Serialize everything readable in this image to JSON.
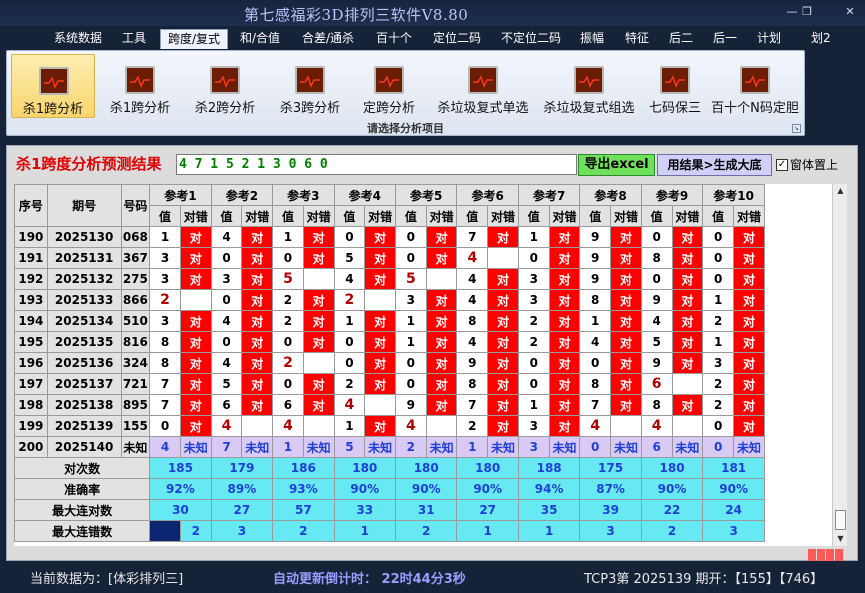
{
  "window": {
    "title": "第七感福彩3D排列三软件V8.80",
    "minimize": "—",
    "restore": "❐",
    "close": "✕"
  },
  "menu": [
    "系统数据",
    "工具",
    "跨度/复式",
    "和/合值",
    "合差/通杀",
    "百十个",
    "定位二码",
    "不定位二码",
    "振幅",
    "特征",
    "后二",
    "后一",
    "计划",
    "划2"
  ],
  "ribbon": {
    "buttons": [
      "杀1跨分析",
      "杀1跨分析",
      "杀2跨分析",
      "杀3跨分析",
      "定跨分析",
      "杀垃圾复式单选",
      "杀垃圾复式组选",
      "七码保三",
      "百十个N码定胆"
    ],
    "group_label": "请选择分析项目"
  },
  "result": {
    "title": "杀1跨度分析预测结果",
    "values": "4 7 1 5 2 1 3 0 6 0",
    "export_button": "导出excel",
    "generate_button": "用结果>生成大底",
    "topmost_label": "窗体置上",
    "topmost_checked": "✓"
  },
  "grid": {
    "headers": {
      "seq": "序号",
      "period": "期号",
      "number": "号码",
      "refs": [
        "参考1",
        "参考2",
        "参考3",
        "参考4",
        "参考5",
        "参考6",
        "参考7",
        "参考8",
        "参考9",
        "参考10"
      ],
      "val": "值",
      "judge": "对错"
    },
    "hit_text": "对",
    "rows": [
      {
        "seq": "190",
        "period": "2025130",
        "number": "068",
        "vals": [
          "1",
          "4",
          "1",
          "0",
          "0",
          "7",
          "1",
          "9",
          "0",
          "0"
        ],
        "hits": [
          1,
          1,
          1,
          1,
          1,
          1,
          1,
          1,
          1,
          1
        ]
      },
      {
        "seq": "191",
        "period": "2025131",
        "number": "367",
        "vals": [
          "3",
          "0",
          "0",
          "5",
          "0",
          "4",
          "0",
          "9",
          "8",
          "0"
        ],
        "hits": [
          1,
          1,
          1,
          1,
          1,
          0,
          1,
          1,
          1,
          1
        ]
      },
      {
        "seq": "192",
        "period": "2025132",
        "number": "275",
        "vals": [
          "3",
          "3",
          "5",
          "4",
          "5",
          "4",
          "3",
          "9",
          "0",
          "0"
        ],
        "hits": [
          1,
          1,
          0,
          1,
          0,
          1,
          1,
          1,
          1,
          1
        ]
      },
      {
        "seq": "193",
        "period": "2025133",
        "number": "866",
        "vals": [
          "2",
          "0",
          "2",
          "2",
          "3",
          "4",
          "3",
          "8",
          "9",
          "1"
        ],
        "hits": [
          0,
          1,
          1,
          0,
          1,
          1,
          1,
          1,
          1,
          1
        ]
      },
      {
        "seq": "194",
        "period": "2025134",
        "number": "510",
        "vals": [
          "3",
          "4",
          "2",
          "1",
          "1",
          "8",
          "2",
          "1",
          "4",
          "2"
        ],
        "hits": [
          1,
          1,
          1,
          1,
          1,
          1,
          1,
          1,
          1,
          1
        ]
      },
      {
        "seq": "195",
        "period": "2025135",
        "number": "816",
        "vals": [
          "8",
          "0",
          "0",
          "0",
          "1",
          "4",
          "2",
          "4",
          "5",
          "1"
        ],
        "hits": [
          1,
          1,
          1,
          1,
          1,
          1,
          1,
          1,
          1,
          1
        ]
      },
      {
        "seq": "196",
        "period": "2025136",
        "number": "324",
        "vals": [
          "8",
          "4",
          "2",
          "0",
          "0",
          "9",
          "0",
          "0",
          "9",
          "3"
        ],
        "hits": [
          1,
          1,
          0,
          1,
          1,
          1,
          1,
          1,
          1,
          1
        ]
      },
      {
        "seq": "197",
        "period": "2025137",
        "number": "721",
        "vals": [
          "7",
          "5",
          "0",
          "2",
          "0",
          "8",
          "0",
          "8",
          "6",
          "2"
        ],
        "hits": [
          1,
          1,
          1,
          1,
          1,
          1,
          1,
          1,
          0,
          1
        ]
      },
      {
        "seq": "198",
        "period": "2025138",
        "number": "895",
        "vals": [
          "7",
          "6",
          "6",
          "4",
          "9",
          "7",
          "1",
          "7",
          "8",
          "2"
        ],
        "hits": [
          1,
          1,
          1,
          0,
          1,
          1,
          1,
          1,
          1,
          1
        ]
      },
      {
        "seq": "199",
        "period": "2025139",
        "number": "155",
        "vals": [
          "0",
          "4",
          "4",
          "1",
          "4",
          "2",
          "3",
          "4",
          "4",
          "0"
        ],
        "hits": [
          1,
          0,
          0,
          1,
          0,
          1,
          1,
          0,
          0,
          1
        ]
      }
    ],
    "miss_positions_note_free": "",
    "last_row": {
      "seq": "200",
      "period": "2025140",
      "number": "未知",
      "vals": [
        "4",
        "7",
        "1",
        "5",
        "2",
        "1",
        "3",
        "0",
        "6",
        "0"
      ],
      "judge": "未知"
    },
    "stats": [
      {
        "label": "对次数",
        "values": [
          "185",
          "179",
          "186",
          "180",
          "180",
          "180",
          "188",
          "175",
          "180",
          "181"
        ]
      },
      {
        "label": "准确率",
        "values": [
          "92%",
          "89%",
          "93%",
          "90%",
          "90%",
          "90%",
          "94%",
          "87%",
          "90%",
          "90%"
        ]
      },
      {
        "label": "最大连对数",
        "values": [
          "30",
          "27",
          "57",
          "33",
          "31",
          "27",
          "35",
          "39",
          "22",
          "24"
        ]
      },
      {
        "label": "最大连错数",
        "values": [
          "2",
          "3",
          "2",
          "1",
          "2",
          "1",
          "1",
          "3",
          "2",
          "3"
        ]
      }
    ]
  },
  "status": {
    "current_data": "当前数据为：[体彩排列三]",
    "countdown": "自动更新倒计时：  22时44分3秒",
    "draw_info": "TCP3第 2025139 期开：【155】【746】"
  },
  "colors": {
    "hit": "#ff0000",
    "stat_bg": "#66e9f3",
    "pending_row": "#d8c9f5",
    "title_red": "#e00000"
  }
}
